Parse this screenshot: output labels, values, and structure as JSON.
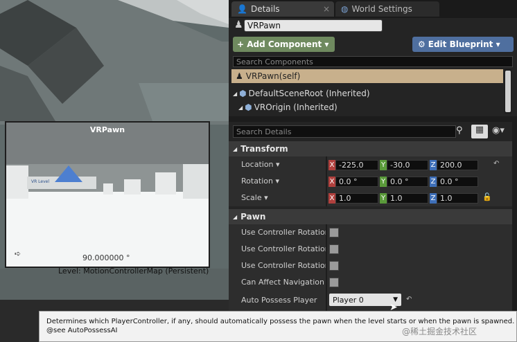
{
  "viewport": {
    "preview": {
      "title": "VRPawn",
      "angle": "90.000000 °",
      "level": "Level:  MotionControllerMap (Persistent)",
      "sign_text": "VR Level"
    }
  },
  "tabs": [
    {
      "label": "Details"
    },
    {
      "label": "World Settings"
    }
  ],
  "actor_name": "VRPawn",
  "toolbar": {
    "add_component": "+ Add Component ▾",
    "edit_blueprint": "Edit Blueprint ▾"
  },
  "components": {
    "search_placeholder": "Search Components",
    "items": [
      "VRPawn(self)",
      "DefaultSceneRoot (Inherited)",
      "VROrigin (Inherited)"
    ]
  },
  "details": {
    "search_placeholder": "Search Details"
  },
  "transform": {
    "title": "Transform",
    "location": {
      "label": "Location ▾",
      "x": "-225.0",
      "y": "-30.0",
      "z": "200.0"
    },
    "rotation": {
      "label": "Rotation ▾",
      "x": "0.0 °",
      "y": "0.0 °",
      "z": "0.0 °"
    },
    "scale": {
      "label": "Scale ▾",
      "x": "1.0",
      "y": "1.0",
      "z": "1.0"
    }
  },
  "pawn": {
    "title": "Pawn",
    "props": [
      "Use Controller Rotation P",
      "Use Controller Rotation Y",
      "Use Controller Rotation R",
      "Can Affect Navigation G"
    ],
    "auto_possess": {
      "label": "Auto Possess Player",
      "value": "Player 0"
    }
  },
  "tooltip": {
    "line1": "Determines which PlayerController, if any, should automatically possess the pawn when the level starts or when the pawn is spawned.",
    "line2": "@see AutoPossessAI"
  },
  "watermark": "@稀土掘金技术社区",
  "colors": {
    "accent_selected": "#c8b08c",
    "add_component": "#6f8a5f",
    "edit_blueprint": "#4f6f9f",
    "axis_x": "#b0403d",
    "axis_y": "#5a9a3a",
    "axis_z": "#3e6fb8"
  }
}
